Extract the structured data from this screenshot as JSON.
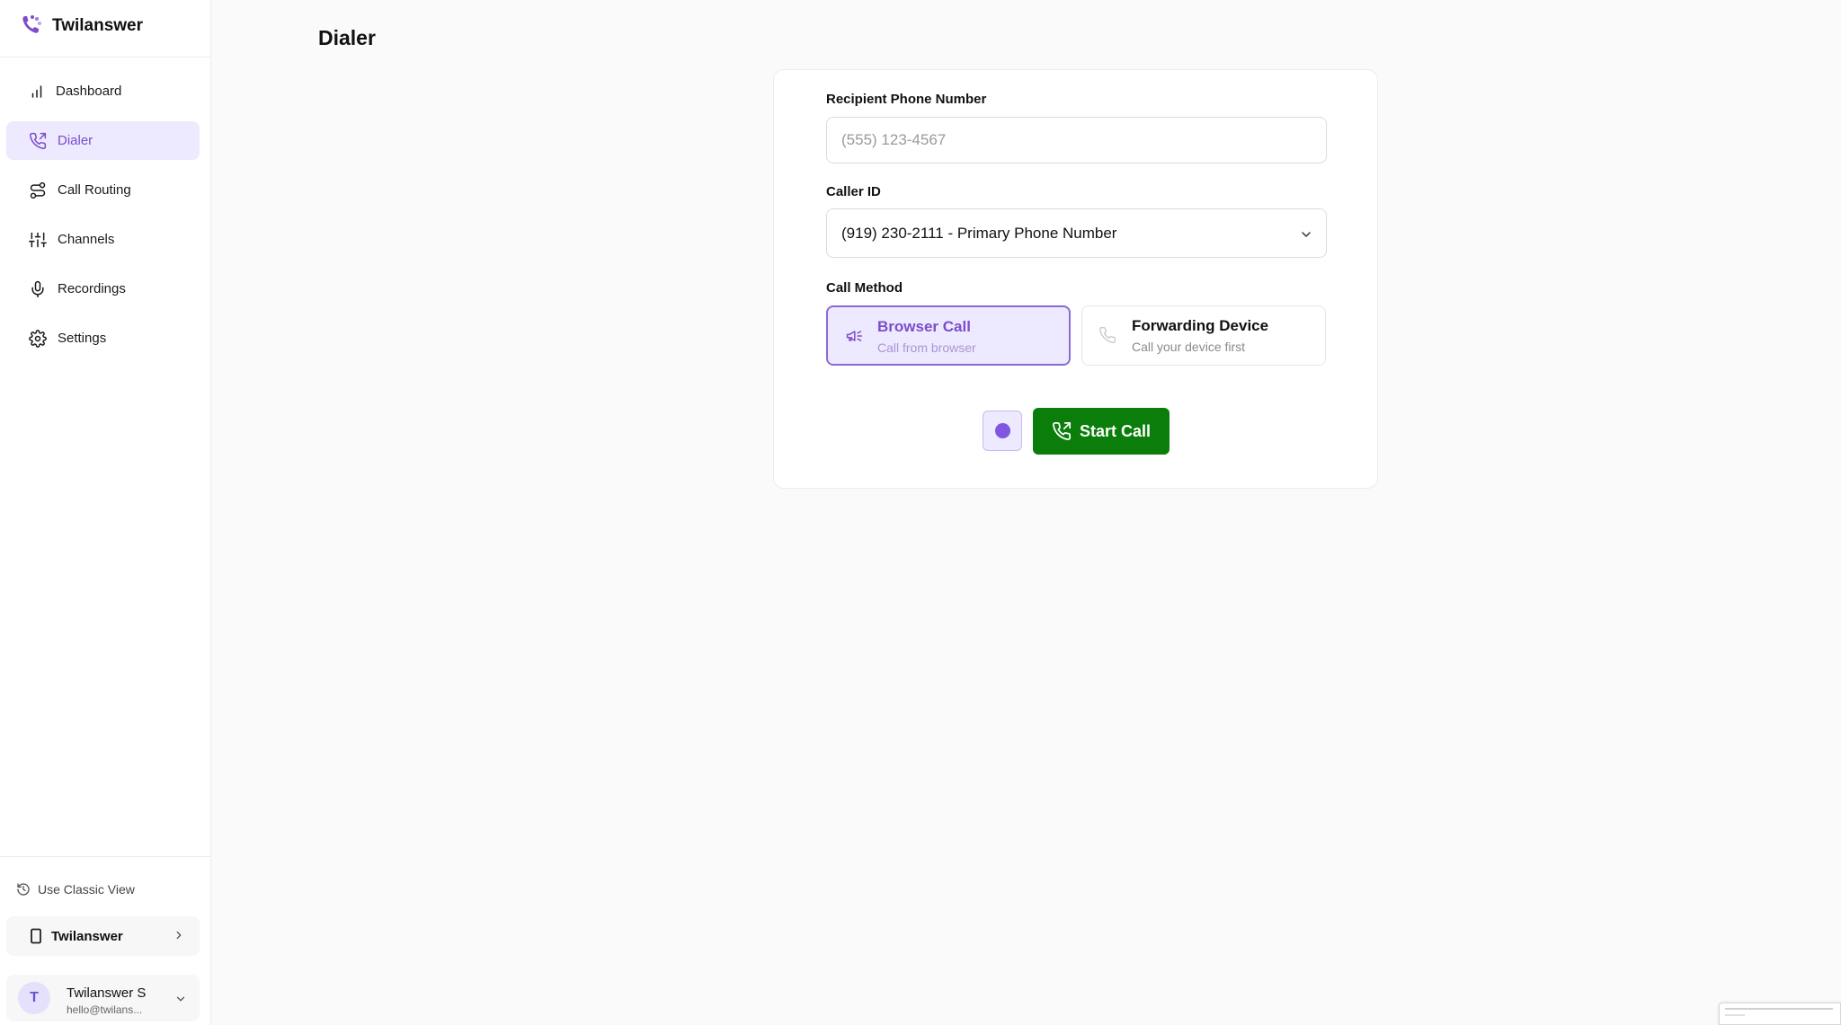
{
  "app": {
    "name": "Twilanswer"
  },
  "sidebar": {
    "items": [
      {
        "label": "Dashboard",
        "icon": "bar-chart-icon",
        "active": false
      },
      {
        "label": "Dialer",
        "icon": "phone-outgoing-icon",
        "active": true
      },
      {
        "label": "Call Routing",
        "icon": "route-icon",
        "active": false
      },
      {
        "label": "Channels",
        "icon": "sliders-icon",
        "active": false
      },
      {
        "label": "Recordings",
        "icon": "microphone-icon",
        "active": false
      },
      {
        "label": "Settings",
        "icon": "gear-icon",
        "active": false
      }
    ],
    "classic_view_label": "Use Classic View",
    "workspace_name": "Twilanswer",
    "user": {
      "initial": "T",
      "name": "Twilanswer S",
      "email": "hello@twilans..."
    }
  },
  "page": {
    "title": "Dialer"
  },
  "form": {
    "recipient_label": "Recipient Phone Number",
    "recipient_placeholder": "(555) 123-4567",
    "recipient_value": "",
    "caller_id_label": "Caller ID",
    "caller_id_value": "(919) 230-2111 - Primary Phone Number",
    "call_method_label": "Call Method",
    "methods": [
      {
        "title": "Browser Call",
        "subtitle": "Call from browser",
        "selected": true
      },
      {
        "title": "Forwarding Device",
        "subtitle": "Call your device first",
        "selected": false
      }
    ],
    "start_call_label": "Start Call"
  },
  "colors": {
    "accent": "#7c4dcc",
    "accent_bg": "#ede9fe",
    "call_button": "#0a7d0a"
  }
}
